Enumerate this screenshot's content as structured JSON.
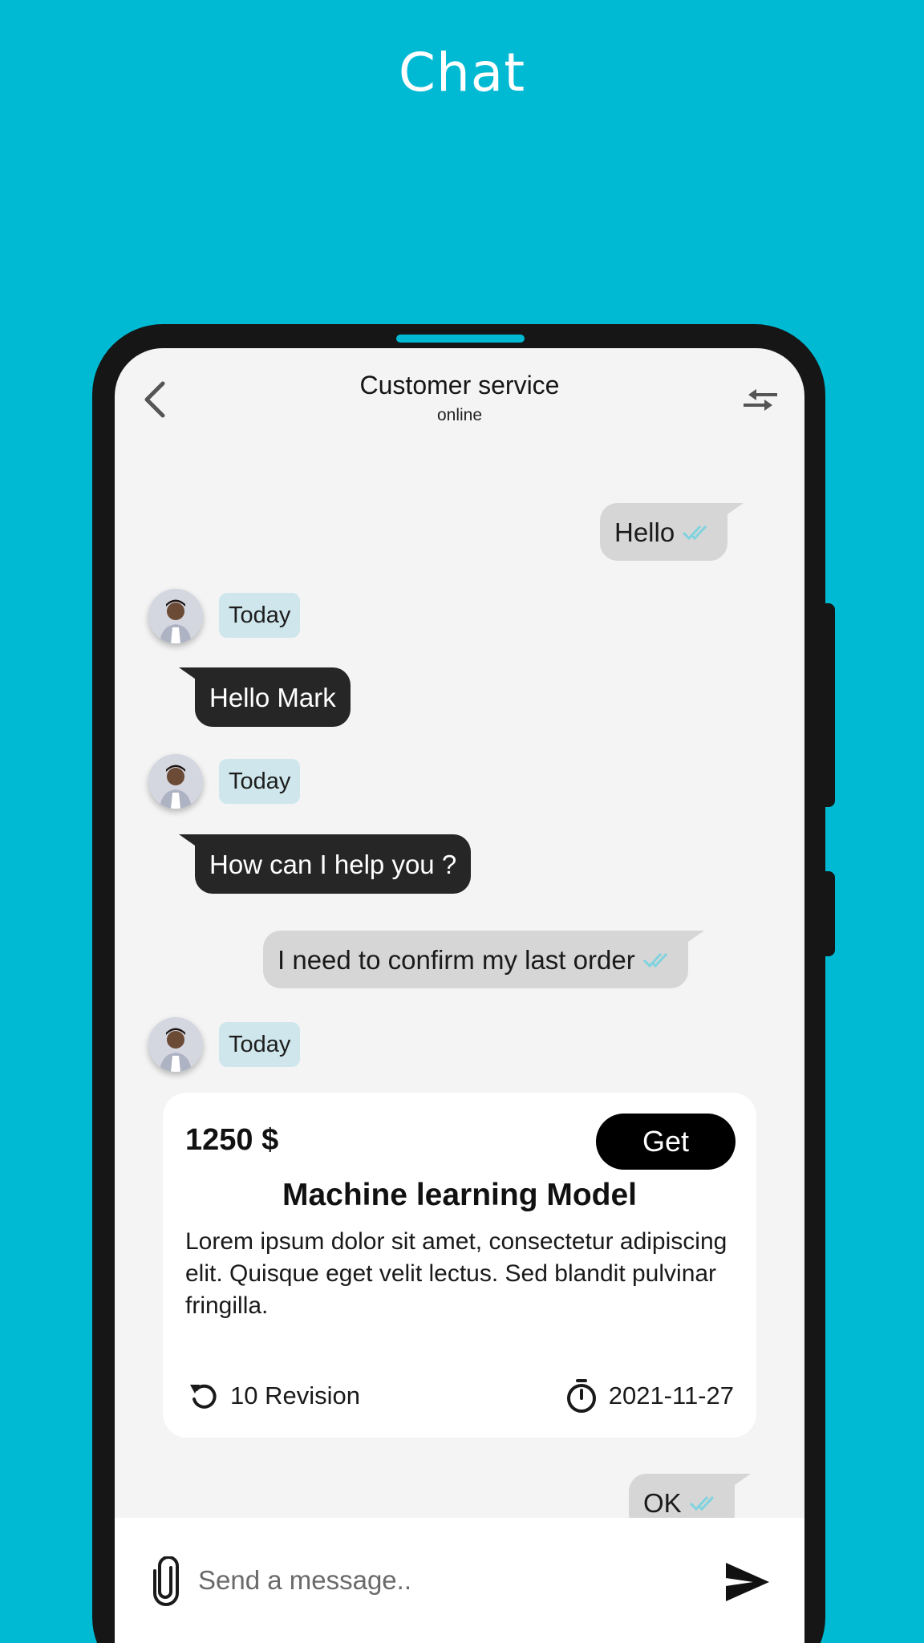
{
  "page": {
    "title": "Chat"
  },
  "header": {
    "title": "Customer service",
    "status": "online",
    "back_icon": "chevron-left-icon",
    "swap_icon": "swap-arrows-icon"
  },
  "messages": [
    {
      "type": "sent",
      "text": "Hello"
    },
    {
      "type": "time",
      "text": "Today"
    },
    {
      "type": "received",
      "text": "Hello Mark"
    },
    {
      "type": "time",
      "text": "Today"
    },
    {
      "type": "received",
      "text": "How can I help you ?"
    },
    {
      "type": "sent",
      "text": "I need to confirm my last order"
    },
    {
      "type": "time",
      "text": "Today"
    },
    {
      "type": "sent",
      "text": "OK"
    }
  ],
  "offer": {
    "price": "1250 $",
    "button": "Get",
    "title": "Machine learning Model",
    "description": "Lorem ipsum dolor sit amet, consectetur adipiscing elit. Quisque eget velit lectus. Sed blandit pulvinar fringilla.",
    "revisions": "10 Revision",
    "date": "2021-11-27"
  },
  "composer": {
    "placeholder": "Send a message.."
  },
  "colors": {
    "background": "#00BAD3",
    "sent_bubble": "#D6D6D6",
    "received_bubble": "#262626",
    "time_tag": "#CFE7EC",
    "read_ticks": "#7FD3DF"
  }
}
